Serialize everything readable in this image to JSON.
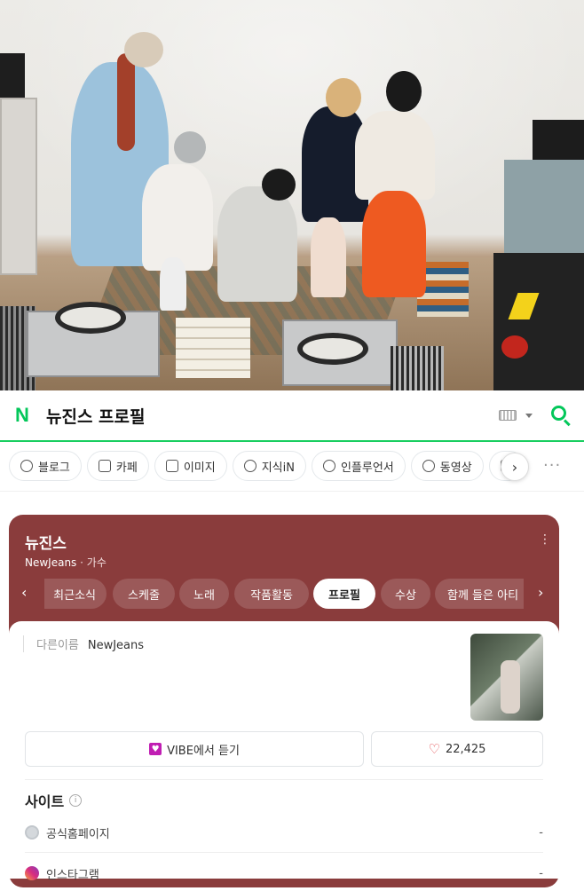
{
  "search": {
    "query": "뉴진스 프로필",
    "logo": "N"
  },
  "tabs": [
    {
      "label": "블로그",
      "icon": "blog-icon"
    },
    {
      "label": "카페",
      "icon": "cafe-icon"
    },
    {
      "label": "이미지",
      "icon": "image-icon"
    },
    {
      "label": "지식iN",
      "icon": "q-icon"
    },
    {
      "label": "인플루언서",
      "icon": "person-icon"
    },
    {
      "label": "동영상",
      "icon": "play-icon"
    }
  ],
  "profile": {
    "name": "뉴진스",
    "name_en": "NewJeans",
    "role": "가수",
    "chips": [
      "최근소식",
      "스케줄",
      "노래",
      "작품활동",
      "프로필",
      "수상",
      "함께 들은 아티"
    ],
    "active_chip": "프로필",
    "alias_label": "다른이름",
    "alias_value": "NewJeans",
    "vibe_button": "VIBE에서 듣기",
    "like_count": "22,425",
    "site_section": "사이트",
    "sites": [
      {
        "label": "공식홈페이지",
        "value": "-"
      },
      {
        "label": "인스타그램",
        "value": "-"
      }
    ]
  },
  "colors": {
    "brand_green": "#03c75a",
    "card_bg": "#8a3c3c"
  }
}
